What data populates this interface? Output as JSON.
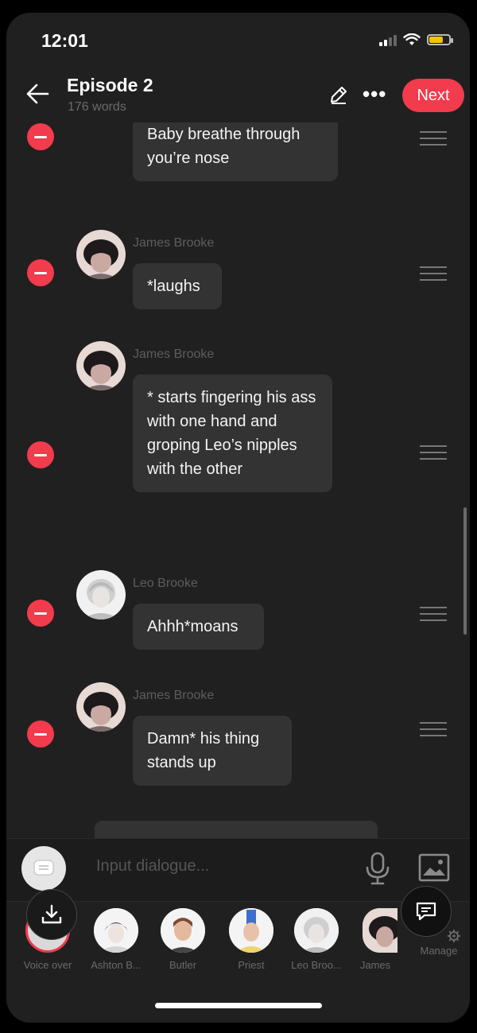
{
  "status": {
    "time": "12:01"
  },
  "header": {
    "title": "Episode 2",
    "subtitle": "176 words",
    "next_label": "Next"
  },
  "messages": [
    {
      "name": "",
      "text": "Baby breathe through you’re nose"
    },
    {
      "name": "James Brooke",
      "text": "*laughs"
    },
    {
      "name": "James Brooke",
      "text": "* starts fingering his ass with one hand and groping Leo’s nipples with the other"
    },
    {
      "name": "Leo Brooke",
      "text": "Ahhh*moans"
    },
    {
      "name": "James Brooke",
      "text": "Damn* his thing stands up"
    }
  ],
  "input": {
    "placeholder": "Input dialogue..."
  },
  "characters": [
    {
      "label": "Voice over"
    },
    {
      "label": "Ashton B..."
    },
    {
      "label": "Butler"
    },
    {
      "label": "Priest"
    },
    {
      "label": "Leo Broo..."
    },
    {
      "label": "James"
    }
  ],
  "manage_label": "Manage",
  "colors": {
    "accent": "#f23b4c",
    "bubble": "#333333",
    "background": "#202020"
  },
  "icons": [
    "back-arrow-icon",
    "edit-pencil-icon",
    "more-icon",
    "minus-icon",
    "drag-handle-icon",
    "chat-icon",
    "mic-icon",
    "image-icon",
    "download-icon",
    "comment-icon",
    "gear-icon"
  ]
}
